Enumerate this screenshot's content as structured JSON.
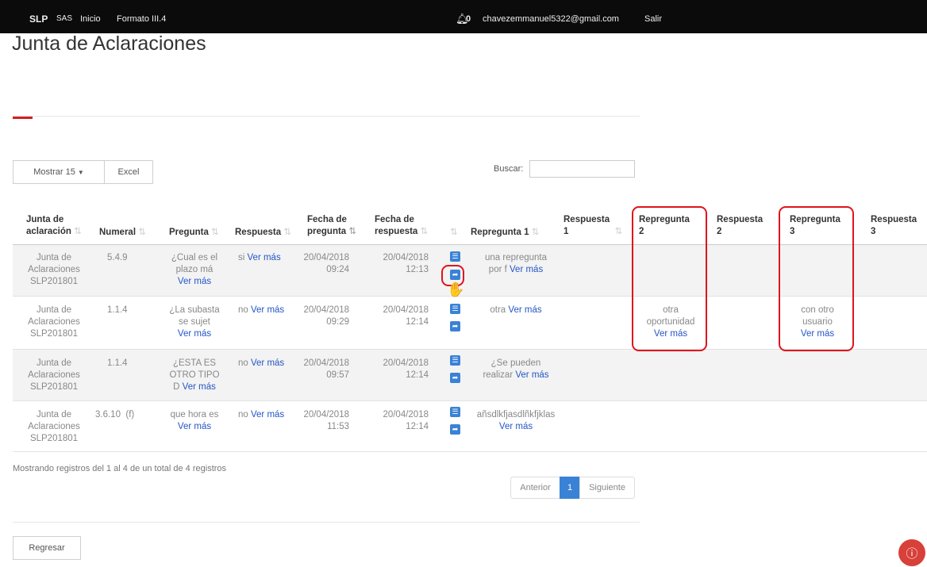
{
  "nav": {
    "brand": "SLP",
    "sas": "SAS",
    "inicio": "Inicio",
    "formato": "Formato III.4",
    "bell_count": "0",
    "email": "chavezemmanuel5322@gmail.com",
    "logout": "Salir"
  },
  "page": {
    "title": "Junta de Aclaraciones"
  },
  "toolbar": {
    "show_label": "Mostrar 15",
    "excel_label": "Excel",
    "search_label": "Buscar:",
    "search_value": ""
  },
  "table": {
    "headers": {
      "junta": [
        "Junta de",
        "aclaración"
      ],
      "numeral": "Numeral",
      "pregunta": "Pregunta",
      "respuesta": "Respuesta",
      "fecha_pregunta": [
        "Fecha de",
        "pregunta"
      ],
      "fecha_respuesta": [
        "Fecha de",
        "respuesta"
      ],
      "repregunta1": "Repregunta 1",
      "respuesta1": [
        "Respuesta",
        "1"
      ],
      "repregunta2": [
        "Repregunta",
        "2"
      ],
      "respuesta2": [
        "Respuesta",
        "2"
      ],
      "repregunta3": [
        "Repregunta",
        "3"
      ],
      "respuesta3": [
        "Respuesta",
        "3"
      ]
    },
    "more": "Ver más",
    "rows": [
      {
        "junta": [
          "Junta de",
          "Aclaraciones",
          "SLP201801"
        ],
        "numeral": "5.4.9",
        "pregunta": [
          "¿Cual es el",
          "plazo má"
        ],
        "respuesta": "si",
        "fp_date": "20/04/2018",
        "fp_time": "09:24",
        "fr_date": "20/04/2018",
        "fr_time": "12:13",
        "repregunta1": [
          "una repregunta",
          "por f"
        ]
      },
      {
        "junta": [
          "Junta de",
          "Aclaraciones",
          "SLP201801"
        ],
        "numeral": "1.1.4",
        "pregunta": [
          "¿La subasta",
          "se sujet"
        ],
        "respuesta": "no",
        "fp_date": "20/04/2018",
        "fp_time": "09:29",
        "fr_date": "20/04/2018",
        "fr_time": "12:14",
        "repregunta1": [
          "otra"
        ],
        "repregunta2": [
          "otra",
          "oportunidad"
        ],
        "repregunta3": [
          "con otro",
          "usuario"
        ]
      },
      {
        "junta": [
          "Junta de",
          "Aclaraciones",
          "SLP201801"
        ],
        "numeral": "1.1.4",
        "pregunta": [
          "¿ESTA ES",
          "OTRO TIPO",
          "D"
        ],
        "respuesta": "no",
        "fp_date": "20/04/2018",
        "fp_time": "09:57",
        "fr_date": "20/04/2018",
        "fr_time": "12:14",
        "repregunta1": [
          "¿Se pueden",
          "realizar"
        ]
      },
      {
        "junta": [
          "Junta de",
          "Aclaraciones",
          "SLP201801"
        ],
        "numeral": "3.6.10",
        "numeral_note": "(f)",
        "pregunta": [
          "que hora es"
        ],
        "respuesta": "no",
        "fp_date": "20/04/2018",
        "fp_time": "11:53",
        "fr_date": "20/04/2018",
        "fr_time": "12:14",
        "repregunta1": [
          "añsdlkfjasdlñkfjklas"
        ]
      }
    ]
  },
  "footer": {
    "info": "Mostrando registros del 1 al 4 de un total de 4 registros",
    "prev": "Anterior",
    "page": "1",
    "next": "Siguiente",
    "back": "Regresar"
  },
  "colors": {
    "topbar": "#0b0b0b",
    "accent": "#d3201f",
    "link": "#2456c6",
    "action_button": "#3a82d6",
    "highlight": "#e0141c"
  }
}
